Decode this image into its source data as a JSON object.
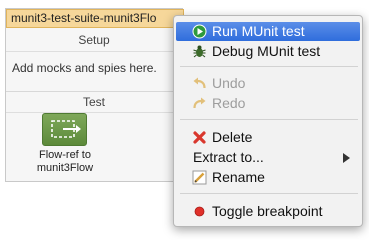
{
  "flow": {
    "title": "munit3-test-suite-munit3Flo",
    "setup_label": "Setup",
    "setup_hint": "Add mocks and spies here.",
    "test_label": "Test",
    "flowref_caption": "Flow-ref to munit3Flow"
  },
  "menu": {
    "items": [
      {
        "label": "Run MUnit test",
        "icon": "run-play-icon",
        "state": "selected"
      },
      {
        "label": "Debug MUnit test",
        "icon": "bug-icon",
        "state": "enabled"
      },
      {
        "label": "Undo",
        "icon": "undo-arrow-icon",
        "state": "disabled"
      },
      {
        "label": "Redo",
        "icon": "redo-arrow-icon",
        "state": "disabled"
      },
      {
        "label": "Delete",
        "icon": "red-x-icon",
        "state": "enabled"
      },
      {
        "label": "Extract to...",
        "icon": "submenu-arrow-icon",
        "state": "enabled"
      },
      {
        "label": "Rename",
        "icon": "pencil-icon",
        "state": "enabled"
      },
      {
        "label": "Toggle breakpoint",
        "icon": "red-dot-icon",
        "state": "enabled"
      }
    ]
  },
  "colors": {
    "selection": "#3a77e0",
    "flow_title_bg": "#f6d79a",
    "flowref_green": "#6b9647",
    "delete_red": "#d9382e",
    "breakpoint_red": "#e0302a"
  }
}
